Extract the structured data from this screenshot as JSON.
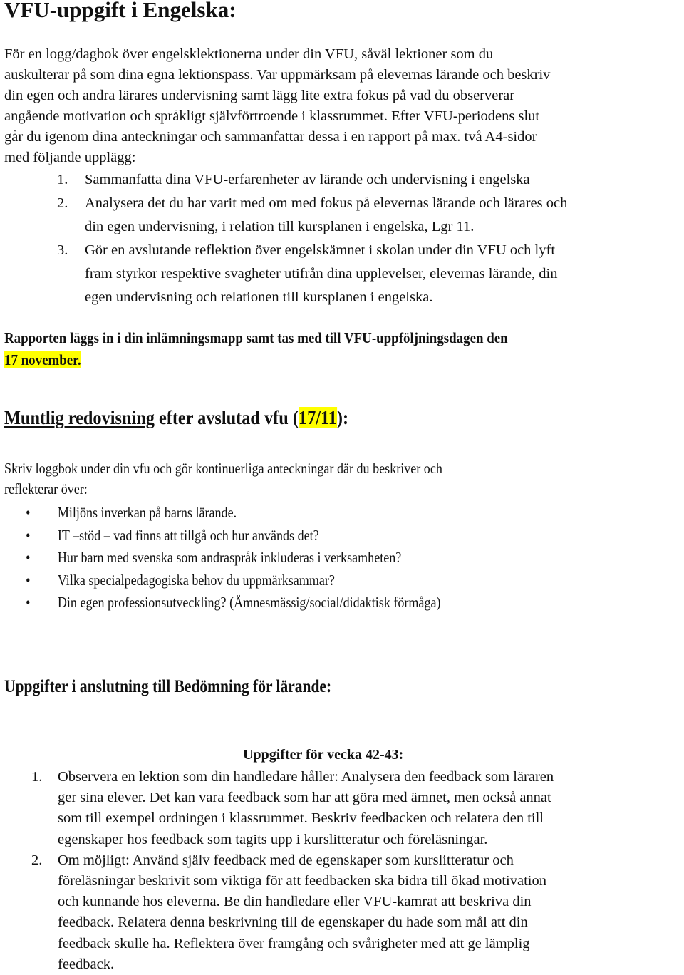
{
  "title": "VFU-uppgift i Engelska:",
  "intro": {
    "lines": [
      "För en logg/dagbok över engelsklektionerna under din VFU, såväl lektioner som du",
      "auskulterar på som dina egna lektionspass. Var uppmärksam på elevernas lärande och beskriv",
      "din egen och andra lärares undervisning samt lägg lite extra fokus på vad du observerar",
      "angående motivation och språkligt självförtroende i klassrummet. Efter VFU-periodens slut",
      "går du igenom dina anteckningar och sammanfattar dessa i en rapport på max. två A4-sidor",
      "med följande upplägg:"
    ]
  },
  "report_structure": [
    {
      "number": "1.",
      "lines": [
        "Sammanfatta dina VFU-erfarenheter av lärande och undervisning i engelska"
      ]
    },
    {
      "number": "2.",
      "lines": [
        "Analysera det du har varit med om med fokus på elevernas lärande och lärares och",
        "din egen undervisning, i relation till kursplanen i engelska, Lgr 11."
      ]
    },
    {
      "number": "3.",
      "lines": [
        "Gör en avslutande reflektion över engelskämnet i skolan under din VFU och lyft",
        "fram styrkor respektive svagheter utifrån dina upplevelser, elevernas lärande, din",
        "egen undervisning och relationen till kursplanen i engelska."
      ]
    }
  ],
  "deadline": {
    "line1": "Rapporten läggs in i din inlämningsmapp samt tas med till VFU-uppföljningsdagen den",
    "date_highlighted": "17 november."
  },
  "highlight_color": "#ffff00",
  "oral_section": {
    "heading_underlined": "Muntlig redovisning",
    "heading_rest_before": " efter avslutad vfu (",
    "heading_date_highlighted": "17/11",
    "heading_rest_after": "):",
    "intro_lines": [
      "Skriv loggbok under din vfu och gör kontinuerliga anteckningar där du beskriver och",
      "reflekterar över:"
    ],
    "bullet_symbol": "•",
    "bullets": [
      "Miljöns inverkan på barns lärande.",
      "IT –stöd – vad finns att tillgå och hur används det?",
      "Hur barn med svenska som andraspråk inkluderas i verksamheten?",
      "Vilka specialpedagogiska behov du uppmärksammar?",
      "Din egen professionsutveckling? (Ämnesmässig/social/didaktisk förmåga)"
    ]
  },
  "assessment_section": {
    "heading": "Uppgifter i anslutning till Bedömning för lärande:",
    "subheading": "Uppgifter för vecka 42-43:",
    "tasks": [
      {
        "number": "1.",
        "lines": [
          "Observera en lektion som din handledare håller: Analysera den feedback som läraren",
          "ger sina elever. Det kan vara feedback som har att göra med ämnet, men också annat",
          "som till exempel ordningen i klassrummet. Beskriv feedbacken och relatera den till",
          "egenskaper hos feedback som tagits upp i kurslitteratur och föreläsningar."
        ]
      },
      {
        "number": "2.",
        "lines": [
          "Om möjligt: Använd själv feedback med de egenskaper som kurslitteratur och",
          "föreläsningar beskrivit som viktiga för att feedbacken ska bidra till ökad motivation",
          "och kunnande hos eleverna. Be din handledare eller VFU-kamrat att beskriva din",
          "feedback. Relatera denna beskrivning till de egenskaper du hade som mål att din",
          "feedback skulle ha. Reflektera över framgång och svårigheter med att ge lämplig",
          "feedback."
        ]
      }
    ]
  }
}
